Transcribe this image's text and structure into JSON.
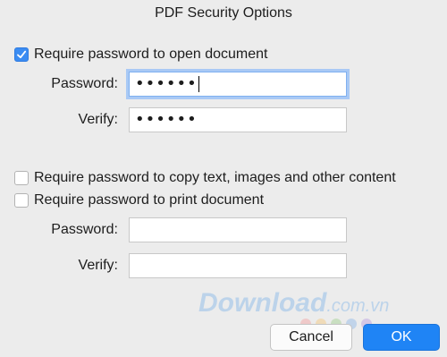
{
  "dialog": {
    "title": "PDF Security Options"
  },
  "open_section": {
    "checkbox_label": "Require password to open document",
    "checked": true,
    "password_label": "Password:",
    "password_value": "••••••",
    "verify_label": "Verify:",
    "verify_value": "••••••"
  },
  "copy_option": {
    "checkbox_label": "Require password to copy text, images and other content",
    "checked": false
  },
  "print_section": {
    "checkbox_label": "Require password to print document",
    "checked": false,
    "password_label": "Password:",
    "password_value": "",
    "verify_label": "Verify:",
    "verify_value": ""
  },
  "watermark": {
    "text": "Download",
    "suffix": ".com.vn"
  },
  "buttons": {
    "cancel_label": "Cancel",
    "ok_label": "OK"
  },
  "colors": {
    "accent": "#1f84f5",
    "checkbox_checked": "#3b8cf2",
    "focus_ring": "#a9c9f5"
  },
  "watermark_dot_colors": [
    "#f4a0a0",
    "#f6c87a",
    "#9fd18f",
    "#8fb8e8",
    "#b79ce0"
  ]
}
